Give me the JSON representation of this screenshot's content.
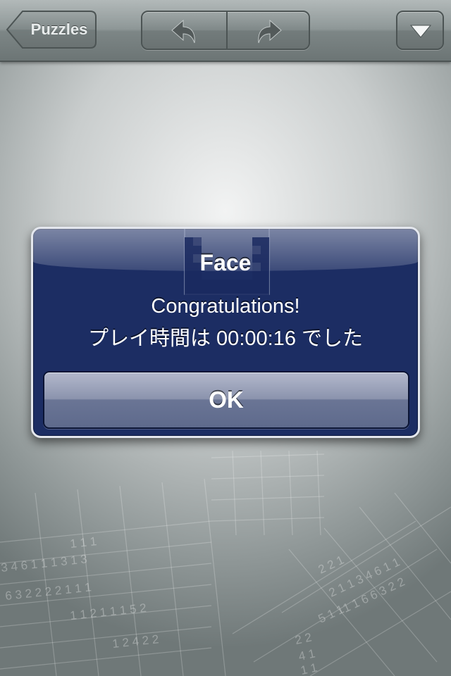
{
  "navbar": {
    "back_label": "Puzzles",
    "undo_icon": "undo-arrow-icon",
    "redo_icon": "redo-arrow-icon",
    "menu_icon": "triangle-down-icon"
  },
  "alert": {
    "title": "Face",
    "message_line1": "Congratulations!",
    "message_line2": "プレイ時間は 00:00:16 でした",
    "ok_label": "OK"
  },
  "background_clues": {
    "left_grid": [
      "1 1 1",
      "3 4 6 1 1 1 3 1 3",
      "6 3 2 2 2 2 1 1 1",
      "1 1 2 1 1 1 5 2",
      "1 2 4 2 2"
    ],
    "right_grid": [
      "2 2 1",
      "2 1 1 3 4 6 1 1",
      "1 1 6 6 3 2 2",
      "5 1 1",
      "2 2",
      "4 1",
      "1 1"
    ]
  },
  "colors": {
    "alert_background": "#1c2d63",
    "alert_border": "#e4e7ee",
    "toolbar": "#8e9797"
  }
}
